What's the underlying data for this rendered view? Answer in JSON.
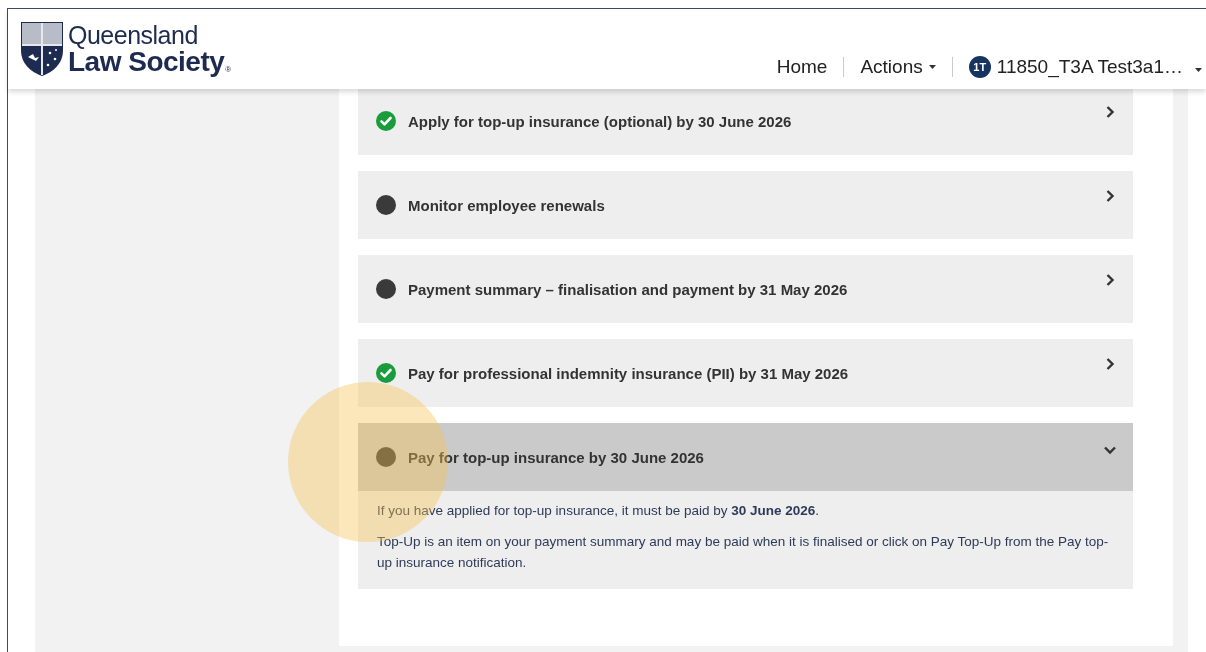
{
  "logo": {
    "line_1": "Queensland",
    "line_2": "Law Society",
    "registered_mark": "®"
  },
  "nav": {
    "items": [
      {
        "label": "Home",
        "kind": "link"
      },
      {
        "label": "Actions",
        "kind": "dropdown"
      }
    ],
    "user": {
      "initials": "1T",
      "name": "11850_T3A Test3a1…"
    }
  },
  "tasks": [
    {
      "title": "Apply for top-up insurance (optional) by 30 June 2026",
      "completed": true,
      "expanded": false
    },
    {
      "title": "Monitor employee renewals",
      "completed": false,
      "expanded": false
    },
    {
      "title": "Payment summary – finalisation and payment by 31 May 2026",
      "completed": false,
      "expanded": false
    },
    {
      "title": "Pay for professional indemnity insurance (PII) by 31 May 2026",
      "completed": true,
      "expanded": false
    },
    {
      "title": "Pay for top-up insurance by 30 June 2026",
      "completed": false,
      "expanded": true,
      "body": [
        "If you have applied for top-up insurance, it must be paid by **30 June 2026**.",
        "Top-Up is an item on your payment summary and may be paid when it is finalised or click on Pay Top-Up from the Pay top-up insurance notification."
      ]
    }
  ]
}
